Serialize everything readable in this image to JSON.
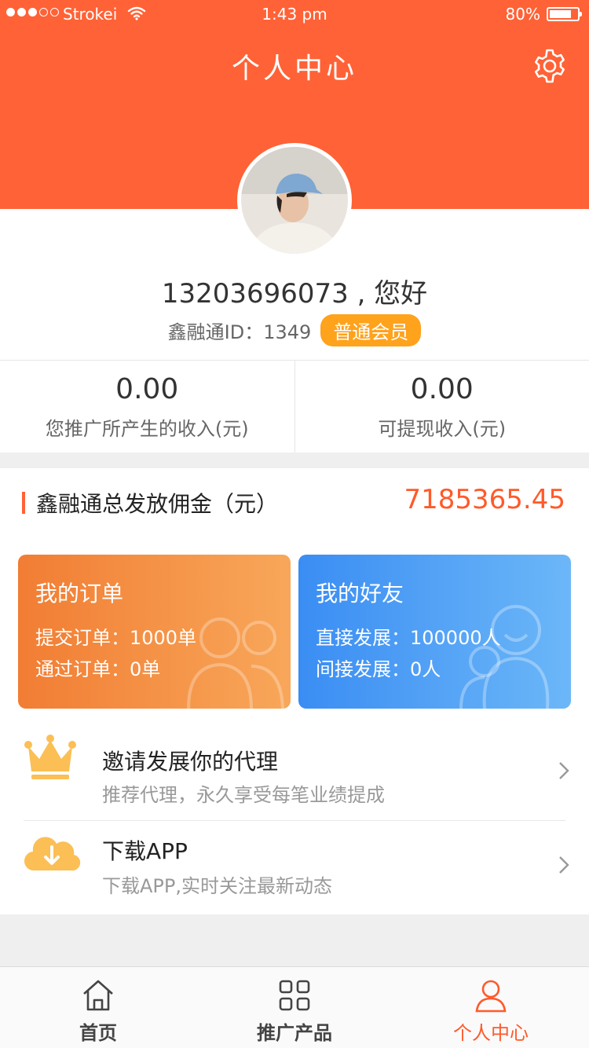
{
  "status_bar": {
    "carrier": "Strokei",
    "time": "1:43 pm",
    "battery": "80%",
    "battery_level": 0.8
  },
  "header": {
    "title": "个人中心",
    "settings_icon": "gear-icon"
  },
  "profile": {
    "greeting": "13203696073 , 您好",
    "id_label": "鑫融通ID：1349",
    "member_badge": "普通会员"
  },
  "income": [
    {
      "value": "0.00",
      "label": "您推广所产生的收入(元)"
    },
    {
      "value": "0.00",
      "label": "可提现收入(元)"
    }
  ],
  "commission": {
    "label": "鑫融通总发放佣金（元）",
    "value": "7185365.45"
  },
  "cards": {
    "orders": {
      "title": "我的订单",
      "line1": "提交订单：1000单",
      "line2": "通过订单：0单"
    },
    "friends": {
      "title": "我的好友",
      "line1": "直接发展：100000人",
      "line2": "间接发展：0人"
    }
  },
  "menu": [
    {
      "icon": "crown-icon",
      "title": "邀请发展你的代理",
      "subtitle": "推荐代理，永久享受每笔业绩提成"
    },
    {
      "icon": "cloud-download-icon",
      "title": "下载APP",
      "subtitle": "下载APP,实时关注最新动态"
    }
  ],
  "tabs": [
    {
      "icon": "home-icon",
      "label": "首页",
      "active": false
    },
    {
      "icon": "grid-icon",
      "label": "推广产品",
      "active": false
    },
    {
      "icon": "user-icon",
      "label": "个人中心",
      "active": true
    }
  ],
  "colors": {
    "brand": "#ff6236",
    "accent_value": "#ff5a2a",
    "badge": "#ffa21c",
    "orders_card": "#f17d33",
    "friends_card": "#3a8df3",
    "icon_yellow": "#fbbf55"
  }
}
